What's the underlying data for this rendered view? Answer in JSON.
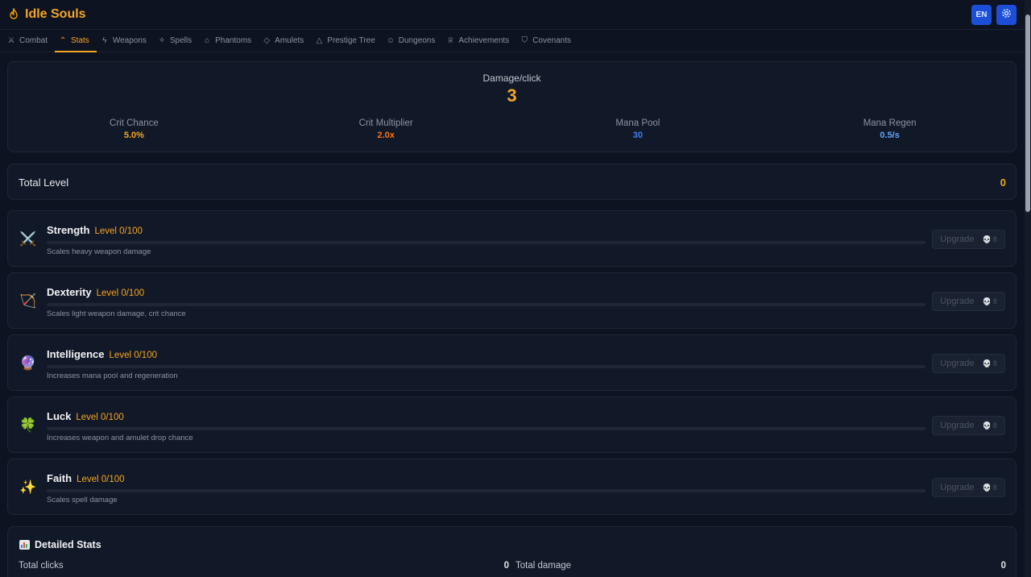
{
  "app": {
    "title": "Idle Souls",
    "icon": "flame-icon"
  },
  "header_buttons": {
    "language": "EN",
    "settings_icon": "gear-icon"
  },
  "tabs": [
    {
      "label": "Combat",
      "icon": "crossed-swords-icon",
      "active": false
    },
    {
      "label": "Stats",
      "icon": "chevron-up-icon",
      "active": true
    },
    {
      "label": "Weapons",
      "icon": "lightning-icon",
      "active": false
    },
    {
      "label": "Spells",
      "icon": "sparkles-icon",
      "active": false
    },
    {
      "label": "Phantoms",
      "icon": "ghost-icon",
      "active": false
    },
    {
      "label": "Amulets",
      "icon": "gem-icon",
      "active": false
    },
    {
      "label": "Prestige Tree",
      "icon": "bell-icon",
      "active": false
    },
    {
      "label": "Dungeons",
      "icon": "skull-icon",
      "active": false
    },
    {
      "label": "Achievements",
      "icon": "trophy-icon",
      "active": false
    },
    {
      "label": "Covenants",
      "icon": "shield-icon",
      "active": false
    }
  ],
  "summary": {
    "damage_label": "Damage/click",
    "damage_value": "3",
    "crit_chance_label": "Crit Chance",
    "crit_chance_value": "5.0%",
    "crit_mult_label": "Crit Multiplier",
    "crit_mult_value": "2.0x",
    "mana_pool_label": "Mana Pool",
    "mana_pool_value": "30",
    "mana_regen_label": "Mana Regen",
    "mana_regen_value": "0.5/s"
  },
  "total_level": {
    "label": "Total Level",
    "value": "0"
  },
  "stats": [
    {
      "name": "Strength",
      "level": "Level 0/100",
      "progress": 0,
      "description": "Scales heavy weapon damage",
      "icon": "crossed-swords-icon",
      "upgrade_label": "Upgrade",
      "cost": "8"
    },
    {
      "name": "Dexterity",
      "level": "Level 0/100",
      "progress": 0,
      "description": "Scales light weapon damage, crit chance",
      "icon": "bow-arrow-icon",
      "upgrade_label": "Upgrade",
      "cost": "8"
    },
    {
      "name": "Intelligence",
      "level": "Level 0/100",
      "progress": 0,
      "description": "Increases mana pool and regeneration",
      "icon": "crystal-ball-icon",
      "upgrade_label": "Upgrade",
      "cost": "8"
    },
    {
      "name": "Luck",
      "level": "Level 0/100",
      "progress": 0,
      "description": "Increases weapon and amulet drop chance",
      "icon": "four-leaf-clover-icon",
      "upgrade_label": "Upgrade",
      "cost": "8"
    },
    {
      "name": "Faith",
      "level": "Level 0/100",
      "progress": 0,
      "description": "Scales spell damage",
      "icon": "sparkles-icon",
      "upgrade_label": "Upgrade",
      "cost": "8"
    }
  ],
  "detailed_stats": {
    "title": "Detailed Stats",
    "icon": "bar-chart-icon",
    "total_clicks_label": "Total clicks",
    "total_clicks_value": "0",
    "total_damage_label": "Total damage",
    "total_damage_value": "0"
  },
  "colors": {
    "accent": "#f5a623",
    "background": "#0d1321",
    "card": "#111827",
    "blue": "#3b82f6"
  }
}
